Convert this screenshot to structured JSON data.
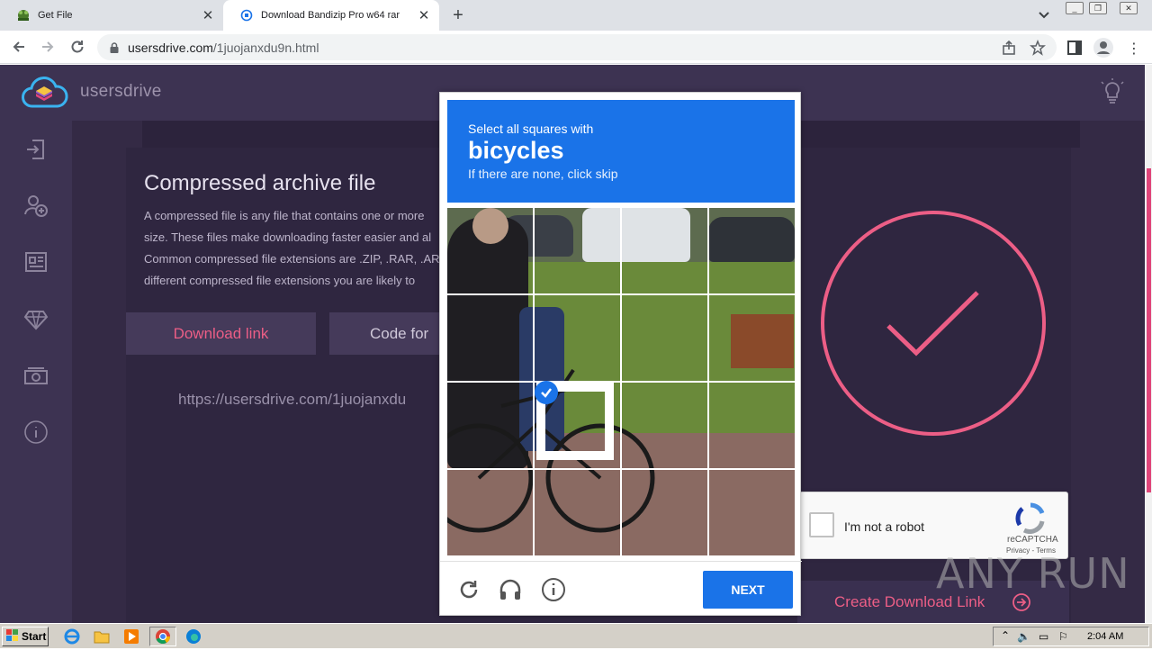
{
  "browser": {
    "tabs": [
      {
        "title": "Get File",
        "active": false
      },
      {
        "title": "Download Bandizip Pro w64 rar",
        "active": true
      }
    ],
    "url_host": "usersdrive.com",
    "url_path": "/1juojanxdu9n.html"
  },
  "site": {
    "brand": "usersdrive",
    "heading": "Compressed archive file",
    "paragraph_lines": [
      "A compressed file is any file that contains one or more",
      "size. These files make downloading faster easier and al",
      "Common compressed file extensions are .ZIP, .RAR, .AR",
      "different compressed file extensions you are likely to"
    ],
    "download_link_label": "Download link",
    "code_label": "Code for",
    "file_url": "https://usersdrive.com/1juojanxdu",
    "create_link_label": "Create Download Link"
  },
  "recaptcha": {
    "checkbox_label": "I'm not a robot",
    "brand": "reCAPTCHA",
    "links": "Privacy - Terms",
    "challenge": {
      "instruction": "Select all squares with",
      "target": "bicycles",
      "skip_hint": "If there are none, click skip",
      "next_label": "NEXT",
      "selected_tiles": [
        "row 3, column 2"
      ]
    }
  },
  "watermark": "ANY RUN",
  "taskbar": {
    "start_label": "Start",
    "clock": "2:04 AM"
  },
  "colors": {
    "accent_pink": "#ec5e86",
    "recaptcha_blue": "#1a73e8",
    "page_bg": "#3b2f4f"
  }
}
